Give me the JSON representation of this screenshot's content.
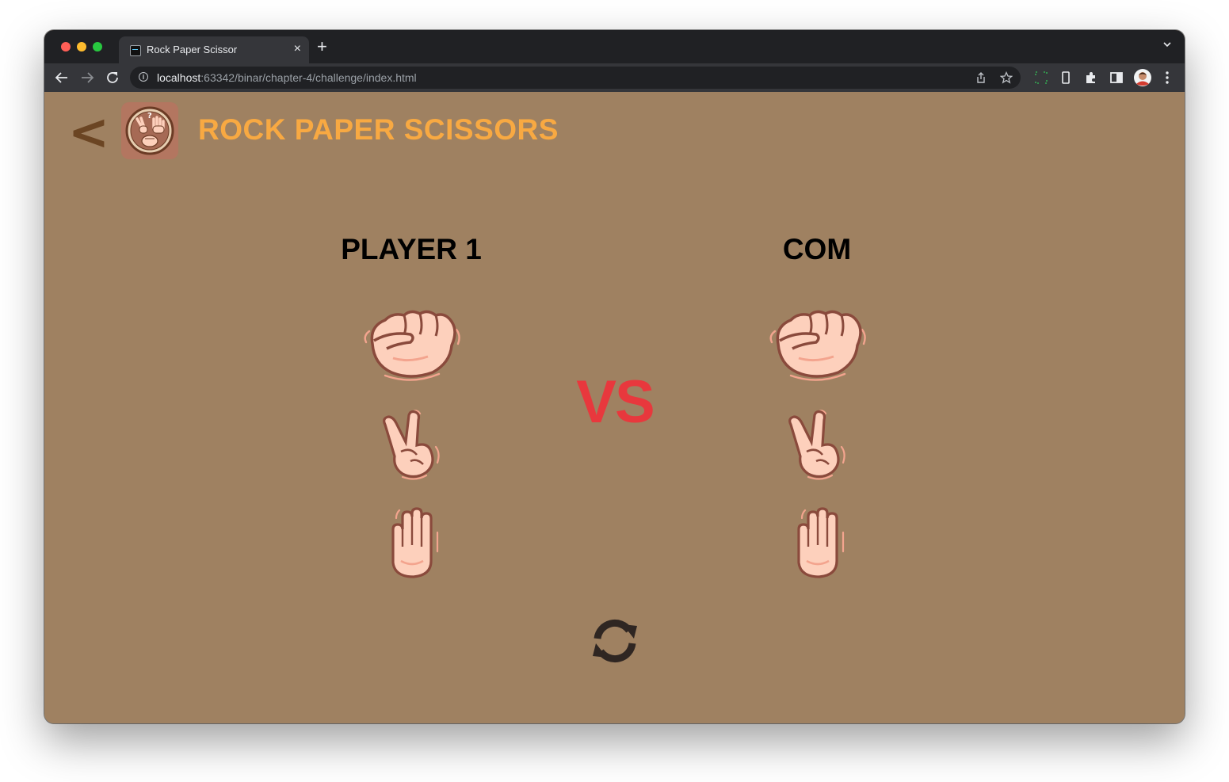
{
  "browser": {
    "tab_title": "Rock Paper Scissor",
    "close_glyph": "×",
    "new_tab_glyph": "+",
    "url_host": "localhost",
    "url_path": ":63342/binar/chapter-4/challenge/index.html"
  },
  "header": {
    "back_glyph": "<",
    "title": "ROCK PAPER SCISSORS"
  },
  "game": {
    "player_label": "PLAYER 1",
    "com_label": "COM",
    "vs_label": "VS",
    "choices": [
      "rock",
      "scissors",
      "paper"
    ]
  },
  "colors": {
    "background": "#9f8161",
    "title": "#f8a942",
    "vs": "#e8383d",
    "back_arrow": "#6b4523",
    "skin": "#fdd0bc",
    "outline": "#8a4a3c"
  }
}
